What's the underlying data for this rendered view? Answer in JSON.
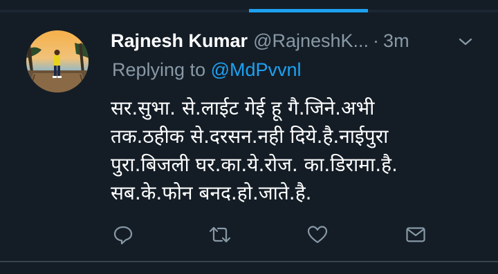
{
  "tweet": {
    "display_name": "Rajnesh Kumar",
    "handle": "@RajneshK...",
    "separator": "·",
    "time": "3m",
    "replying_prefix": "Replying to",
    "replying_to": "@MdPvvnl",
    "body_lines": [
      "सर.सुभा. से.लाईट गेई हू गै.जिने.अभी",
      "तक.ठहीक से.दरसन.नही दिये.है.नाईपुरा",
      "पुरा.बिजली घर.का.ये.रोज. का.डिरामा.है.",
      "सब.के.फोन बनद.हो.जाते.है."
    ]
  },
  "icons": {
    "reply": "reply-icon",
    "retweet": "retweet-icon",
    "like": "heart-icon",
    "message": "envelope-icon",
    "more": "chevron-down-icon"
  },
  "colors": {
    "background": "#141d26",
    "secondary_text": "#8899a6",
    "accent": "#1da1f2",
    "icon": "#8899a6"
  }
}
